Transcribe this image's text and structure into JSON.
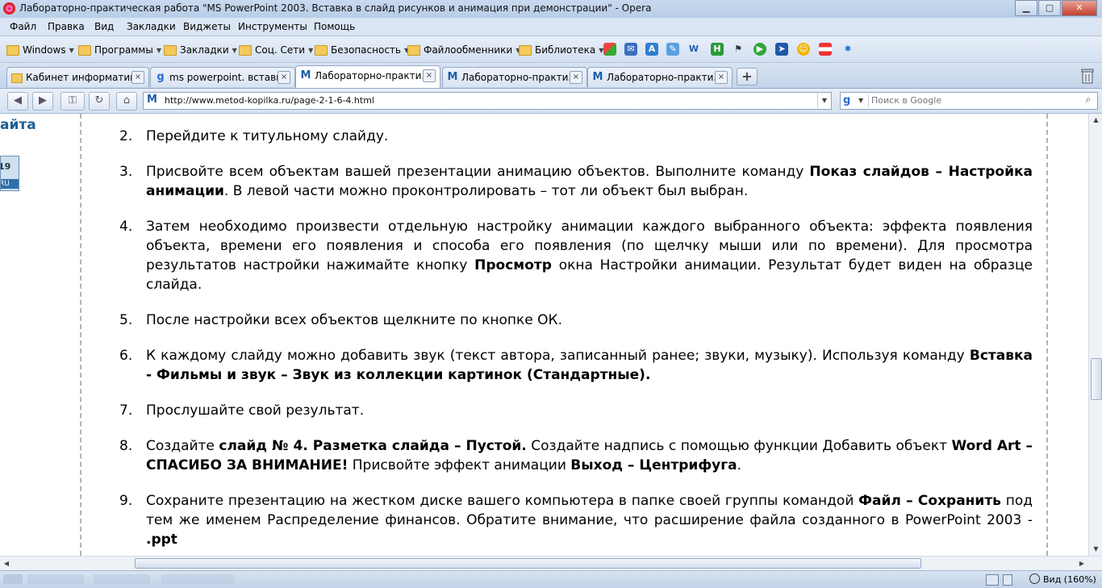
{
  "window": {
    "title": "Лабораторно-практическая работа \"MS PowerPoint 2003. Вставка в слайд рисунков и анимация при демонстрации\" - Opera",
    "buttons": {
      "minimize": "▁",
      "maximize": "▢",
      "close": "✕"
    }
  },
  "menu": [
    "Файл",
    "Правка",
    "Вид",
    "Закладки",
    "Виджеты",
    "Инструменты",
    "Помощь"
  ],
  "bookmarks": {
    "folders": [
      "Windows",
      "Программы",
      "Закладки",
      "Соц. Сети",
      "Безопасность",
      "Файлообменники",
      "Библиотека"
    ],
    "icons": [
      "windows-logo-icon",
      "mail-icon",
      "translate-icon",
      "pen-icon",
      "word-icon",
      "h-icon",
      "flag-icon",
      "play-icon",
      "arrow-icon",
      "smiley-icon",
      "stripe-icon",
      "gear-icon"
    ]
  },
  "tabs": [
    {
      "label": "Кабинет информатик...",
      "active": false
    },
    {
      "label": "ms powerpoint. вставк...",
      "active": false
    },
    {
      "label": "Лабораторно-практи...",
      "active": true
    },
    {
      "label": "Лабораторно-практи...",
      "active": false
    },
    {
      "label": "Лабораторно-практи...",
      "active": false
    }
  ],
  "tab_close": "×",
  "new_tab": "+",
  "address": {
    "url": "http://www.metod-kopilka.ru/page-2-1-6-4.html"
  },
  "search": {
    "placeholder": "Поиск в Google"
  },
  "sidebar": {
    "heading_fragment": "айта",
    "calendar_day": "19",
    "calendar_suffix": "RU"
  },
  "steps": [
    {
      "num": "2.",
      "parts": [
        {
          "t": "Перейдите к титульному слайду."
        }
      ]
    },
    {
      "num": "3.",
      "parts": [
        {
          "t": "Присвойте всем объектам вашей презентации анимацию объектов. Выполните команду "
        },
        {
          "t": "Показ слайдов – Настройка анимации",
          "b": true
        },
        {
          "t": ". В левой части можно проконтролировать – тот ли объект был выбран."
        }
      ]
    },
    {
      "num": "4.",
      "parts": [
        {
          "t": "Затем необходимо произвести отдельную настройку анимации каждого выбранного объекта: эффекта появления объекта, времени его появления и способа его появления (по щелчку мыши или по времени). Для просмотра результатов настройки нажимайте кнопку "
        },
        {
          "t": "Просмотр",
          "b": true
        },
        {
          "t": " окна Настройки анимации. Результат будет виден на образце слайда."
        }
      ]
    },
    {
      "num": "5.",
      "parts": [
        {
          "t": "После настройки всех объектов щелкните по кнопке ОК."
        }
      ]
    },
    {
      "num": "6.",
      "parts": [
        {
          "t": "К каждому слайду можно добавить звук (текст автора, записанный ранее; звуки, музыку). Используя команду "
        },
        {
          "t": "Вставка - Фильмы и звук – Звук из коллекции картинок (Стандартные).",
          "b": true
        }
      ]
    },
    {
      "num": "7.",
      "parts": [
        {
          "t": "Прослушайте свой результат."
        }
      ]
    },
    {
      "num": "8.",
      "parts": [
        {
          "t": "Создайте "
        },
        {
          "t": "слайд № 4. Разметка слайда – Пустой.",
          "b": true
        },
        {
          "t": " Создайте надпись с помощью функции Добавить объект "
        },
        {
          "t": "Word Art – СПАСИБО ЗА ВНИМАНИЕ!",
          "b": true
        },
        {
          "t": " Присвойте эффект анимации "
        },
        {
          "t": "Выход – Центрифуга",
          "b": true
        },
        {
          "t": "."
        }
      ]
    },
    {
      "num": "9.",
      "parts": [
        {
          "t": "Сохраните презентацию на жестком диске вашего компьютера в папке своей группы командой "
        },
        {
          "t": "Файл – Сохранить",
          "b": true
        },
        {
          "t": " под тем же именем Распределение финансов. Обратите внимание, что расширение файла созданного в PowerPoint 2003 - "
        },
        {
          "t": ".ppt",
          "b": true
        }
      ]
    }
  ],
  "status": {
    "zoom": "Вид (160%)"
  }
}
